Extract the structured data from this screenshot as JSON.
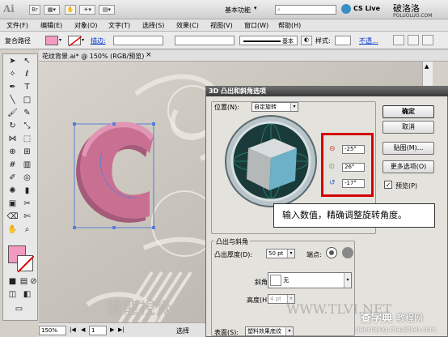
{
  "app": {
    "logo": "Ai",
    "workspace": "基本功能",
    "cs_live": "CS Live",
    "watermark_top": "破洛洛",
    "watermark_url": "POLUOLUO.COM"
  },
  "menu": [
    "文件(F)",
    "编辑(E)",
    "对象(O)",
    "文字(T)",
    "选择(S)",
    "效果(C)",
    "视图(V)",
    "窗口(W)",
    "帮助(H)"
  ],
  "control": {
    "mode": "复合路径",
    "stroke_label": "描边:",
    "basic": "基本",
    "style_label": "样式:",
    "transparency": "不透..."
  },
  "document": {
    "tab": "花纹背景.ai* @ 150% (RGB/预览)",
    "zoom": "150%",
    "page": "1",
    "status": "选择"
  },
  "dialog": {
    "title": "3D 凸出和斜角选项",
    "position_label": "位置(N):",
    "position_value": "自定旋转",
    "rot_x": "-25°",
    "rot_y": "26°",
    "rot_z": "-17°",
    "ok": "确定",
    "cancel": "取消",
    "map": "贴图(M)...",
    "more": "更多选项(O)",
    "preview": "预览(P)",
    "extrude_section": "凸出与斜角",
    "extrude_depth_label": "凸出厚度(D):",
    "extrude_depth": "50 pt",
    "cap_label": "端点:",
    "bevel_label": "斜角:",
    "bevel_value": "无",
    "height_label": "高度(H):",
    "height_value": "4 pt",
    "surface_label": "表面(S):",
    "surface_value": "塑料效果底纹"
  },
  "tooltip": "输入数值，精确调整旋转角度。",
  "watermark_bottom": {
    "cn": "查字典",
    "cn2": "教程网",
    "url": "jiaocheng.chazidian.com",
    "brand": "騰龍視覺",
    "brand_url": "WWW.TLVI.NET"
  },
  "colors": {
    "accent_red": "#d40000",
    "fill_pink": "#f29ac0",
    "letter_pink": "#c97092",
    "cube_face": "#6cb1c8"
  }
}
